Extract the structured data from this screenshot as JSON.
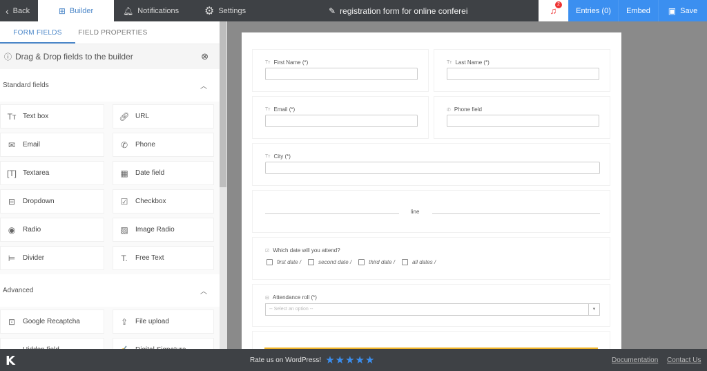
{
  "topbar": {
    "back_label": "Back",
    "builder_label": "Builder",
    "notifications_label": "Notifications",
    "settings_label": "Settings",
    "form_title": "registration form for online conferei",
    "notification_count": "2",
    "entries_label": "Entries (0)",
    "embed_label": "Embed",
    "save_label": "Save"
  },
  "sidebar": {
    "tabs": [
      {
        "label": "FORM FIELDS",
        "active": true
      },
      {
        "label": "FIELD PROPERTIES",
        "active": false
      }
    ],
    "hint": "Drag & Drop fields to the builder",
    "sections": [
      {
        "title": "Standard fields",
        "items": [
          {
            "label": "Text box",
            "icon": "text-icon"
          },
          {
            "label": "URL",
            "icon": "link-icon"
          },
          {
            "label": "Email",
            "icon": "envelope-icon"
          },
          {
            "label": "Phone",
            "icon": "phone-icon"
          },
          {
            "label": "Textarea",
            "icon": "textarea-icon"
          },
          {
            "label": "Date field",
            "icon": "calendar-icon"
          },
          {
            "label": "Dropdown",
            "icon": "dropdown-icon"
          },
          {
            "label": "Checkbox",
            "icon": "checkbox-icon"
          },
          {
            "label": "Radio",
            "icon": "radio-icon"
          },
          {
            "label": "Image Radio",
            "icon": "image-radio-icon"
          },
          {
            "label": "Divider",
            "icon": "divider-icon"
          },
          {
            "label": "Free Text",
            "icon": "free-text-icon"
          }
        ]
      },
      {
        "title": "Advanced",
        "items": [
          {
            "label": "Google Recaptcha",
            "icon": "recaptcha-icon"
          },
          {
            "label": "File upload",
            "icon": "upload-icon"
          },
          {
            "label": "Hidden field",
            "icon": "hidden-field-icon"
          },
          {
            "label": "Digital Signature",
            "icon": "signature-icon"
          }
        ]
      }
    ]
  },
  "form": {
    "fields": {
      "first_name": "First Name (*)",
      "last_name": "Last Name (*)",
      "email": "Email (*)",
      "phone": "Phone field",
      "city": "City (*)",
      "divider": "line",
      "dates_question": "Which date will you attend?",
      "date_options": [
        "first date /",
        "second date /",
        "third date /",
        "all dates /"
      ],
      "attendance": "Attendance roll (*)",
      "attendance_placeholder": "-- Select an option --"
    }
  },
  "footer": {
    "logo": "K",
    "rate_text": "Rate us on WordPress!",
    "stars": "★★★★★",
    "documentation": "Documentation",
    "contact": "Contact Us"
  },
  "colors": {
    "accent": "#3b8ff0",
    "topbar_bg": "#3e4145",
    "badge": "#e33333",
    "submit_bar": "#f0b429"
  }
}
